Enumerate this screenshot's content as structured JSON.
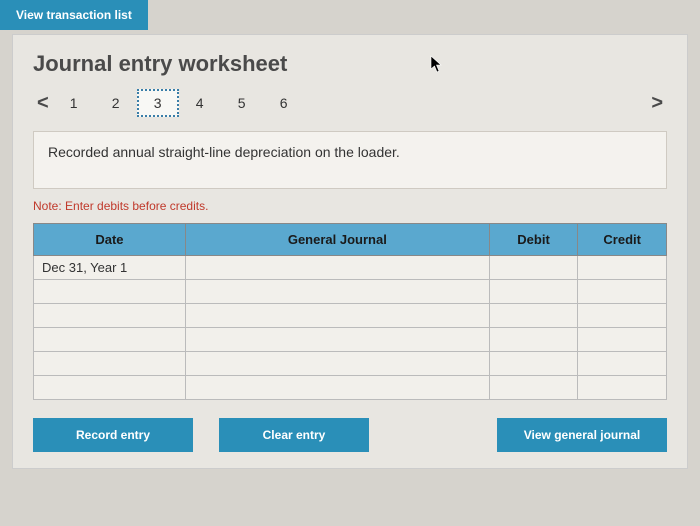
{
  "top_button": "View transaction list",
  "title": "Journal entry worksheet",
  "pager": {
    "prev": "<",
    "next": ">",
    "items": [
      "1",
      "2",
      "3",
      "4",
      "5",
      "6"
    ],
    "selected_index": 2
  },
  "description": "Recorded annual straight-line depreciation on the loader.",
  "note": "Note: Enter debits before credits.",
  "table": {
    "headers": {
      "date": "Date",
      "gj": "General Journal",
      "debit": "Debit",
      "credit": "Credit"
    },
    "rows": [
      {
        "date": "Dec 31, Year 1",
        "gj": "",
        "debit": "",
        "credit": ""
      },
      {
        "date": "",
        "gj": "",
        "debit": "",
        "credit": ""
      },
      {
        "date": "",
        "gj": "",
        "debit": "",
        "credit": ""
      },
      {
        "date": "",
        "gj": "",
        "debit": "",
        "credit": ""
      },
      {
        "date": "",
        "gj": "",
        "debit": "",
        "credit": ""
      },
      {
        "date": "",
        "gj": "",
        "debit": "",
        "credit": ""
      }
    ]
  },
  "buttons": {
    "record": "Record entry",
    "clear": "Clear entry",
    "view": "View general journal"
  }
}
